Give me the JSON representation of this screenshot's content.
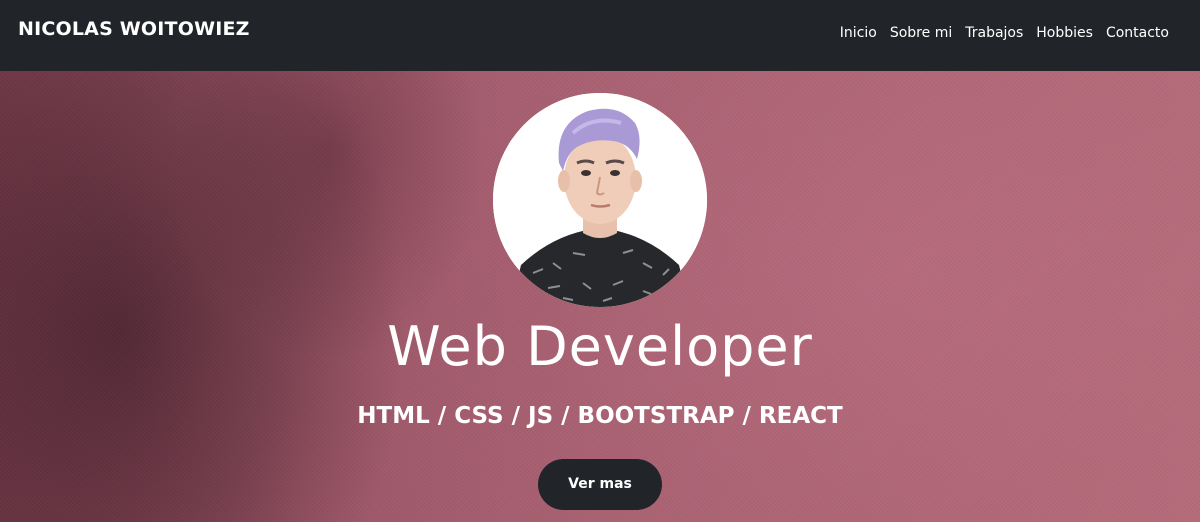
{
  "navbar": {
    "brand": "NICOLAS WOITOWIEZ",
    "links": [
      {
        "label": "Inicio"
      },
      {
        "label": "Sobre mi"
      },
      {
        "label": "Trabajos"
      },
      {
        "label": "Hobbies"
      },
      {
        "label": "Contacto"
      }
    ]
  },
  "hero": {
    "title": "Web Developer",
    "subtitle": "HTML / CSS / JS / BOOTSTRAP / REACT",
    "button_label": "Ver mas"
  },
  "colors": {
    "navbar_bg": "#212529",
    "hero_bg": "#a75f6f",
    "button_bg": "#212529",
    "text": "#ffffff"
  }
}
